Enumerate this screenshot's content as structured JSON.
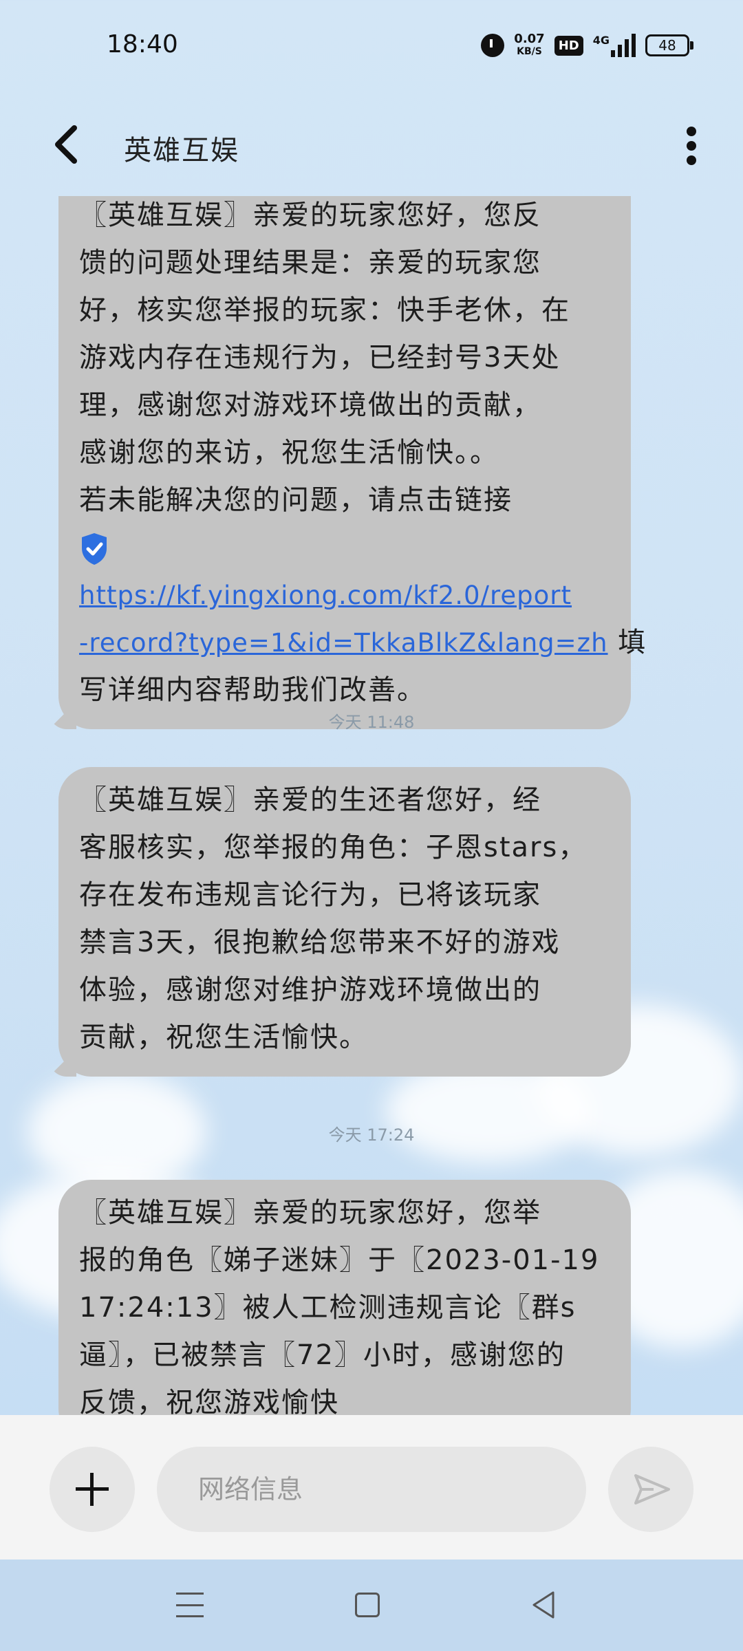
{
  "status_bar": {
    "time": "18:40",
    "net_speed_value": "0.07",
    "net_speed_unit": "KB/S",
    "hd_label": "HD",
    "network_label": "4G",
    "battery": "48"
  },
  "header": {
    "title": "英雄互娱"
  },
  "messages": [
    {
      "lines": [
        "〖英雄互娱〗亲爱的玩家您好，您反",
        "馈的问题处理结果是：亲爱的玩家您",
        "好，核实您举报的玩家：快手老休，在",
        "游戏内存在违规行为，已经封号3天处",
        "理，感谢您对游戏环境做出的贡献，",
        "感谢您的来访，祝您生活愉快。。",
        "若未能解决您的问题，请点击链接"
      ],
      "link_line1": "https://kf.yingxiong.com/kf2.0/report",
      "link_line2": "-record?type=1&id=TkkaBlkZ&lang=zh",
      "link_suffix": " 填",
      "tail_line": "写详细内容帮助我们改善。"
    },
    {
      "lines": [
        "〖英雄互娱〗亲爱的生还者您好，经",
        "客服核实，您举报的角色：子恩stars，",
        "存在发布违规言论行为，已将该玩家",
        "禁言3天，很抱歉给您带来不好的游戏",
        "体验，感谢您对维护游戏环境做出的",
        "贡献，祝您生活愉快。"
      ]
    },
    {
      "lines": [
        "〖英雄互娱〗亲爱的玩家您好，您举",
        "报的角色〖娣子迷妹〗于〖2023-01-19",
        "17:24:13〗被人工检测违规言论〖群s",
        "逼〗，已被禁言〖72〗小时，感谢您的",
        "反馈，祝您游戏愉快"
      ]
    }
  ],
  "timestamps": [
    "今天 11:48",
    "今天 17:24"
  ],
  "input": {
    "placeholder": "网络信息"
  },
  "colors": {
    "bubble": "#c4c4c4",
    "link": "#2a66d9",
    "background": "#d3e6f6"
  },
  "icons": [
    "back-icon",
    "more-icon",
    "shield-icon",
    "plus-icon",
    "send-icon",
    "menu-icon",
    "home-icon",
    "back-nav-icon"
  ]
}
